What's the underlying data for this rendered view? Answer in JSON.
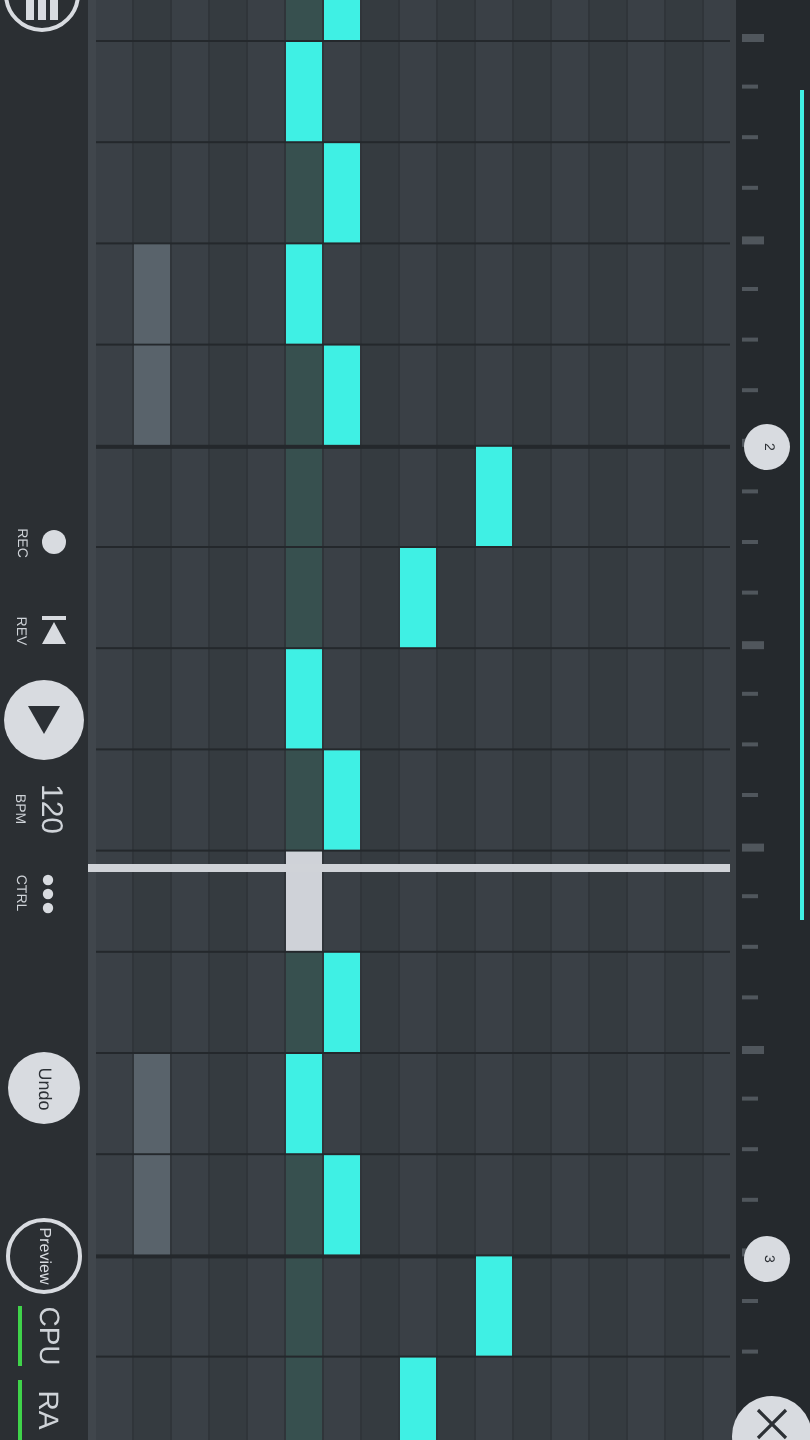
{
  "sidebar": {
    "controls": [
      {
        "kind": "record",
        "label": "REC"
      },
      {
        "kind": "rewind",
        "label": "REV"
      },
      {
        "kind": "play"
      },
      {
        "kind": "bpm",
        "label": "BPM",
        "value": "120"
      },
      {
        "kind": "ctrl",
        "label": "CTRL"
      },
      {
        "kind": "undo",
        "label": "Undo"
      },
      {
        "kind": "preview",
        "label": "Preview"
      },
      {
        "kind": "meter",
        "label": "CPU"
      },
      {
        "kind": "meter",
        "label": "RA"
      }
    ]
  },
  "ruler": {
    "markers": [
      "2",
      "3"
    ]
  }
}
